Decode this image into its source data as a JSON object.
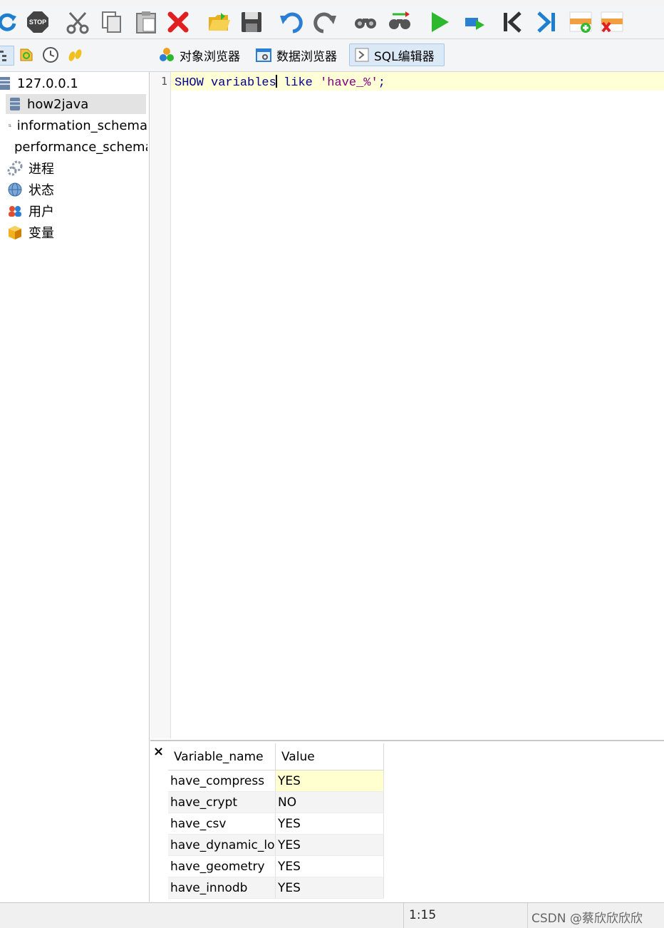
{
  "toolbar": {
    "buttons": [
      {
        "name": "refresh-icon",
        "color": "#1e7fd0"
      },
      {
        "name": "stop-icon",
        "label": "STOP",
        "color": "#444444"
      },
      {
        "name": "cut-icon",
        "color": "#666666"
      },
      {
        "name": "copy-icon",
        "color": "#777777"
      },
      {
        "name": "paste-icon",
        "color": "#777777"
      },
      {
        "name": "delete-icon",
        "color": "#e02020"
      },
      {
        "name": "open-folder-icon",
        "color": "#e0a000"
      },
      {
        "name": "save-icon",
        "color": "#444444"
      },
      {
        "name": "undo-icon",
        "color": "#2a7fd4"
      },
      {
        "name": "redo-icon",
        "color": "#666666"
      },
      {
        "name": "find-icon",
        "color": "#555555"
      },
      {
        "name": "replace-icon",
        "color": "#555555"
      },
      {
        "name": "run-icon",
        "color": "#2db82d"
      },
      {
        "name": "run-selection-icon",
        "color": "#2a7fd4"
      },
      {
        "name": "first-record-icon",
        "color": "#333333"
      },
      {
        "name": "last-record-icon",
        "color": "#1e7fd0"
      },
      {
        "name": "add-row-icon",
        "color": "#f0a040"
      },
      {
        "name": "delete-row-icon",
        "color": "#f0a040"
      }
    ]
  },
  "subtoolbar": {
    "side_buttons": [
      "tree-view-icon",
      "refresh-object-icon",
      "history-icon",
      "favorites-icon"
    ],
    "tabs": [
      {
        "label": "对象浏览器",
        "icon": "object-browser-icon"
      },
      {
        "label": "数据浏览器",
        "icon": "data-browser-icon"
      },
      {
        "label": "SQL编辑器",
        "icon": "sql-editor-icon",
        "active": true
      }
    ]
  },
  "sidebar": {
    "root": "127.0.0.1",
    "items": [
      {
        "label": "how2java",
        "icon": "database-icon",
        "selected": true
      },
      {
        "label": "information_schema",
        "icon": "system-database-icon"
      },
      {
        "label": "performance_schema",
        "icon": "system-database-icon"
      },
      {
        "label": "进程",
        "icon": "process-icon"
      },
      {
        "label": "状态",
        "icon": "status-icon"
      },
      {
        "label": "用户",
        "icon": "users-icon"
      },
      {
        "label": "变量",
        "icon": "variables-icon"
      }
    ]
  },
  "editor": {
    "line_number": "1",
    "tokens": {
      "kw1": "SHOW",
      "word1": "variables",
      "word2": "like",
      "str": "'have_%'",
      "end": ";"
    }
  },
  "results": {
    "close": "×",
    "columns": [
      "Variable_name",
      "Value"
    ],
    "rows": [
      [
        "have_compress",
        "YES"
      ],
      [
        "have_crypt",
        "NO"
      ],
      [
        "have_csv",
        "YES"
      ],
      [
        "have_dynamic_lo",
        "YES"
      ],
      [
        "have_geometry",
        "YES"
      ],
      [
        "have_innodb",
        "YES"
      ]
    ]
  },
  "statusbar": {
    "position": "1:15",
    "watermark": "CSDN @蔡欣欣欣欣"
  }
}
